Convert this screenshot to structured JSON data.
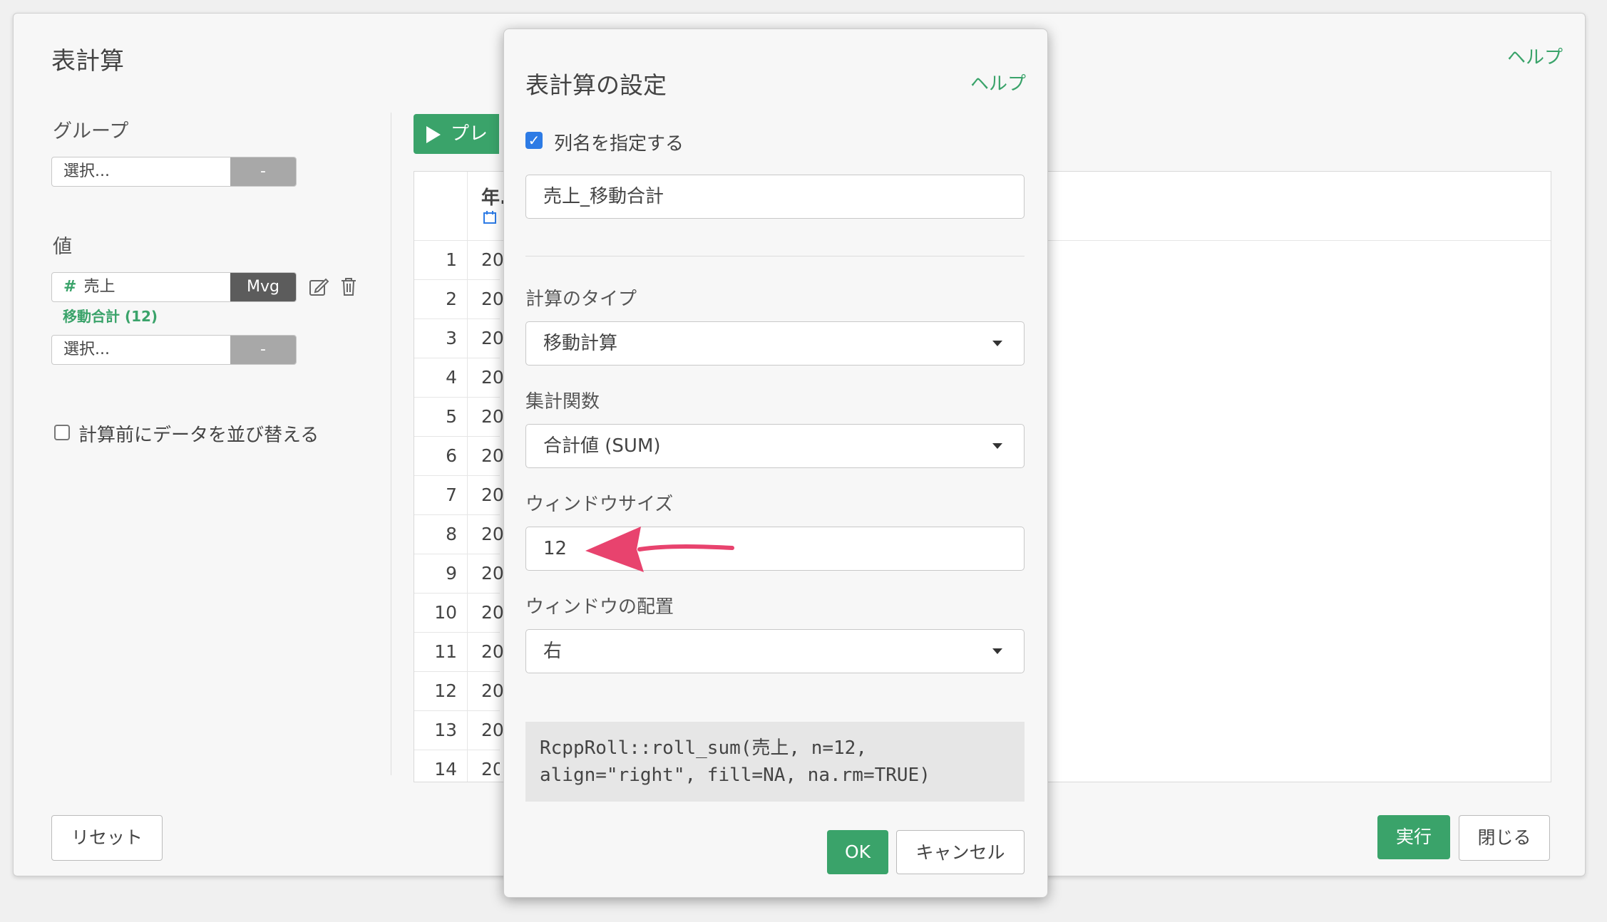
{
  "main": {
    "title": "表計算",
    "help": "ヘルプ",
    "group_label": "グループ",
    "group_select": {
      "placeholder": "選択...",
      "button": "-"
    },
    "value_label": "値",
    "value_item": {
      "hash": "#",
      "name": "売上",
      "button": "Mvg",
      "sub": "移動合計 (12)"
    },
    "value_select": {
      "placeholder": "選択...",
      "button": "-"
    },
    "sort_checkbox_label": "計算前にデータを並び替える",
    "preview_button": "プレ",
    "table_header": "年.",
    "rows": [
      {
        "n": "1",
        "v": "20"
      },
      {
        "n": "2",
        "v": "20"
      },
      {
        "n": "3",
        "v": "20"
      },
      {
        "n": "4",
        "v": "20"
      },
      {
        "n": "5",
        "v": "20"
      },
      {
        "n": "6",
        "v": "20"
      },
      {
        "n": "7",
        "v": "20"
      },
      {
        "n": "8",
        "v": "20"
      },
      {
        "n": "9",
        "v": "20"
      },
      {
        "n": "10",
        "v": "20"
      },
      {
        "n": "11",
        "v": "20"
      },
      {
        "n": "12",
        "v": "20"
      },
      {
        "n": "13",
        "v": "20"
      },
      {
        "n": "14",
        "v": "20"
      }
    ],
    "reset_button": "リセット",
    "run_button": "実行",
    "close_button": "閉じる"
  },
  "dialog": {
    "title": "表計算の設定",
    "help": "ヘルプ",
    "specify_name_label": "列名を指定する",
    "column_name": "売上_移動合計",
    "calc_type_label": "計算のタイプ",
    "calc_type_value": "移動計算",
    "agg_label": "集計関数",
    "agg_value": "合計値 (SUM)",
    "window_size_label": "ウィンドウサイズ",
    "window_size_value": "12",
    "window_align_label": "ウィンドウの配置",
    "window_align_value": "右",
    "code_line1": "RcppRoll::roll_sum(売上, n=12,",
    "code_line2": "align=\"right\", fill=NA, na.rm=TRUE)",
    "ok_button": "OK",
    "cancel_button": "キャンセル"
  },
  "colors": {
    "accent_green": "#3aa36a",
    "arrow": "#e8436e",
    "checkbox_blue": "#2d7be5"
  }
}
